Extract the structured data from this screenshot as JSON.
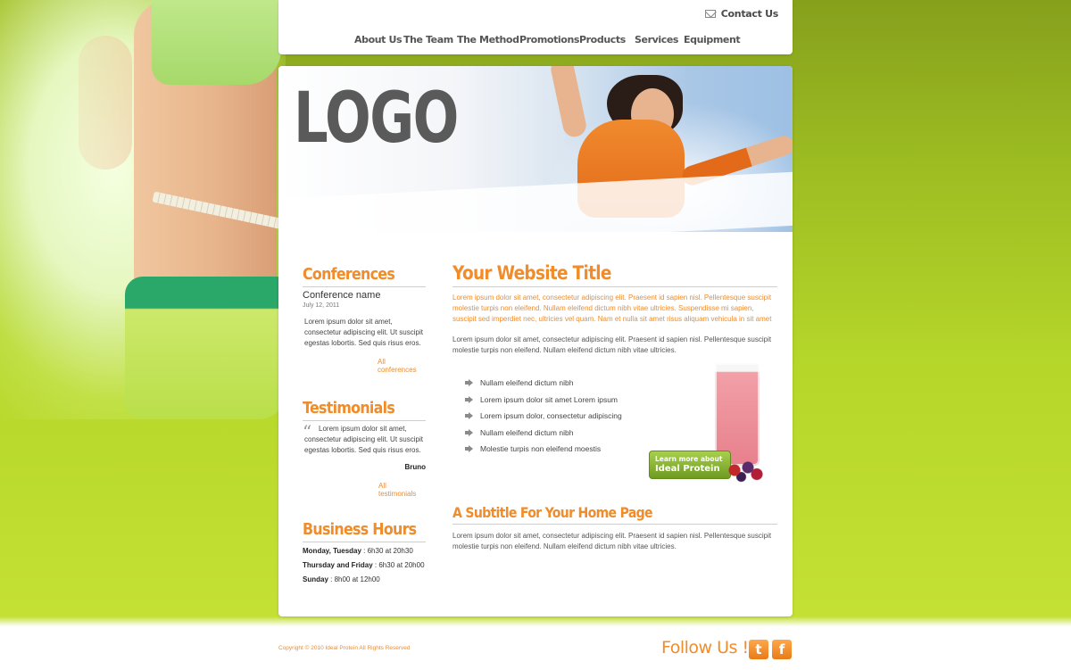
{
  "header": {
    "contact_label": "Contact Us",
    "nav": [
      "About Us",
      "The Team",
      "The Method",
      "Promotions",
      "Products",
      "Services",
      "Equipment"
    ]
  },
  "hero": {
    "logo_text": "LOGO"
  },
  "sidebar": {
    "conferences": {
      "heading": "Conferences",
      "name": "Conference name",
      "date": "July 12, 2011",
      "text": "Lorem ipsum dolor sit amet, consectetur adipiscing elit. Ut suscipit egestas lobortis. Sed quis risus eros.",
      "link": "All conferences"
    },
    "testimonials": {
      "heading": "Testimonials",
      "text": "Lorem ipsum dolor sit amet, consectetur adipiscing elit. Ut suscipit egestas lobortis. Sed quis risus eros.",
      "author": "Bruno",
      "link": "All testimonials"
    },
    "hours": {
      "heading": "Business Hours",
      "lines": [
        {
          "day": "Monday, Tuesday",
          "time": " : 6h30 at 20h30"
        },
        {
          "day": "Thursday and Friday",
          "time": " : 6h30 at 20h00"
        },
        {
          "day": "Sunday",
          "time": " : 8h00 at 12h00"
        }
      ]
    }
  },
  "main": {
    "title": "Your Website Title",
    "lead": "Lorem ipsum dolor sit amet, consectetur adipiscing elit. Praesent id sapien nisl. Pellentesque suscipit molestie turpis non eleifend. Nullam eleifend dictum nibh vitae ultricies. Suspendisse mi sapien, suscipit sed imperdiet nec, ultricies vel quam. Nam et nulla sit amet risus aliquam vehicula in sit amet",
    "paragraph": "Lorem ipsum dolor sit amet, consectetur adipiscing elit. Praesent id sapien nisl. Pellentesque suscipit molestie turpis non eleifend. Nullam eleifend dictum nibh vitae ultricies.",
    "bullets": [
      "Nullam eleifend dictum nibh",
      "Lorem ipsum dolor sit amet Lorem ipsum",
      "Lorem ipsum dolor, consectetur adipiscing",
      "Nullam eleifend dictum nibh",
      "Molestie turpis non eleifend moestis"
    ],
    "promo": {
      "line1": "Learn more about",
      "line2": "Ideal Protein"
    },
    "subtitle": "A Subtitle For Your Home Page",
    "subtitle_paragraph": "Lorem ipsum dolor sit amet, consectetur adipiscing elit. Praesent id sapien nisl. Pellentesque suscipit molestie turpis non eleifend. Nullam eleifend dictum nibh vitae ultricies."
  },
  "footer": {
    "copyright": "Copyright © 2010 Ideal Protein All Rights Reserved",
    "follow": "Follow Us !",
    "social": [
      {
        "name": "twitter-icon",
        "glyph": "t"
      },
      {
        "name": "facebook-icon",
        "glyph": "f"
      }
    ]
  },
  "colors": {
    "accent": "#f08c2a",
    "background_green": "#b6d72a",
    "text_gray": "#555555"
  }
}
